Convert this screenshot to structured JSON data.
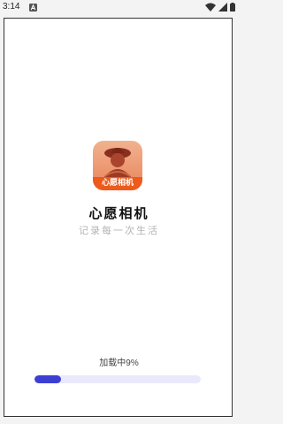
{
  "status_bar": {
    "time": "3:14"
  },
  "app": {
    "name": "心愿相机",
    "slogan": "记录每一次生活",
    "logo_label": "心愿相机"
  },
  "loading": {
    "label": "加载中9%",
    "progress": 0.16
  },
  "colors": {
    "accent": "#3d3fd3",
    "track": "#e9e9fb",
    "logo_banner": "#ee5a1c"
  }
}
